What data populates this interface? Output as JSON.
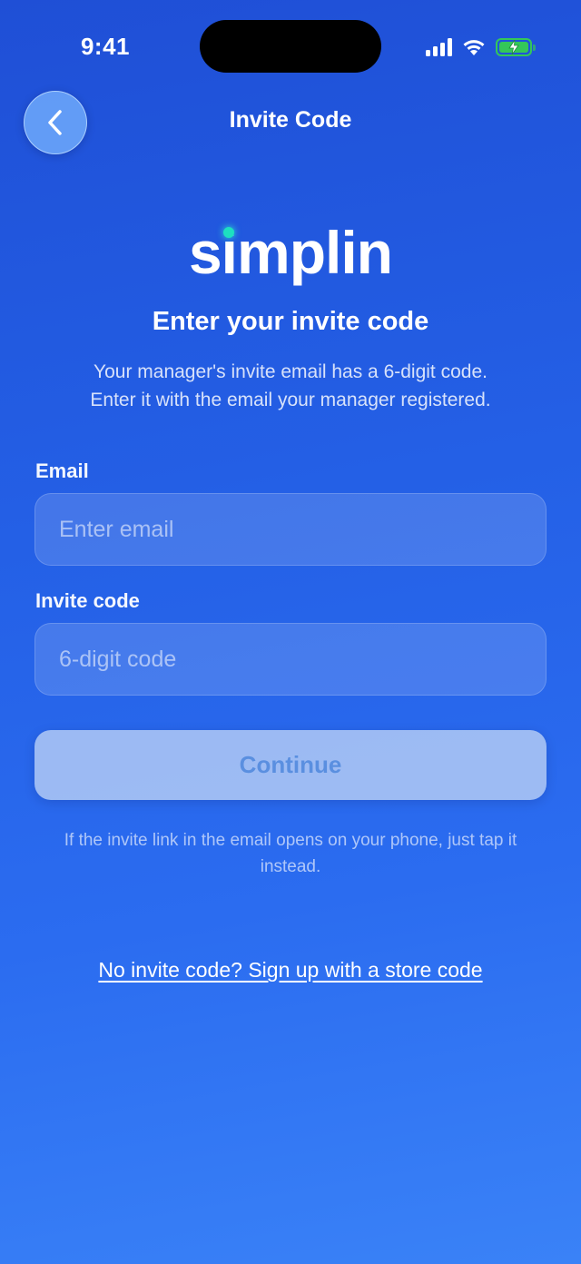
{
  "status_bar": {
    "time": "9:41"
  },
  "nav": {
    "title": "Invite Code",
    "back_icon": "chevron-left-icon"
  },
  "brand": {
    "logo_text": "simplin",
    "dot_color": "#1de0c0"
  },
  "header": {
    "heading": "Enter your invite code",
    "subtext_line1": "Your manager's invite email has a 6-digit code.",
    "subtext_line2": "Enter it with the email your manager registered."
  },
  "form": {
    "email": {
      "label": "Email",
      "placeholder": "Enter email",
      "value": ""
    },
    "invite_code": {
      "label": "Invite code",
      "placeholder": "6-digit code",
      "value": ""
    },
    "continue_label": "Continue"
  },
  "hint": "If the invite link in the email opens on your phone, just tap it instead.",
  "signup_link": "No invite code? Sign up with a store code",
  "colors": {
    "background_top": "#1f4fd6",
    "background_bottom": "#3a82f7",
    "button_text": "#5a8fe0",
    "battery": "#34c759"
  }
}
